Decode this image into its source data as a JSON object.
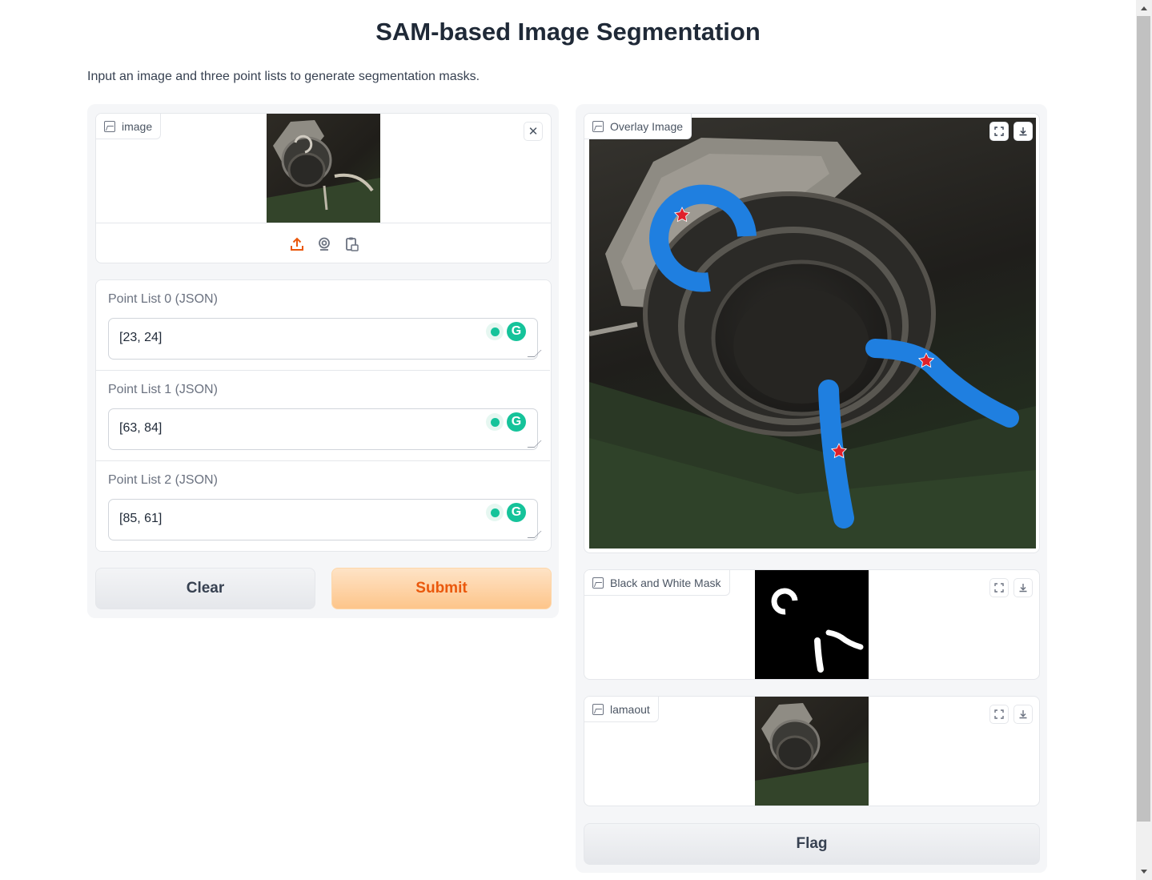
{
  "header": {
    "title": "SAM-based Image Segmentation",
    "subtitle": "Input an image and three point lists to generate segmentation masks."
  },
  "input_image": {
    "label": "image",
    "upload_icon": "upload-icon",
    "webcam_icon": "webcam-icon",
    "clipboard_icon": "clipboard-icon",
    "close_icon": "close-icon"
  },
  "fields": [
    {
      "label": "Point List 0 (JSON)",
      "value": "[23, 24]"
    },
    {
      "label": "Point List 1 (JSON)",
      "value": "[63, 84]"
    },
    {
      "label": "Point List 2 (JSON)",
      "value": "[85, 61]"
    }
  ],
  "grammarly_label": "G",
  "buttons": {
    "clear": "Clear",
    "submit": "Submit",
    "flag": "Flag"
  },
  "outputs": {
    "overlay": {
      "label": "Overlay Image"
    },
    "mask": {
      "label": "Black and White Mask"
    },
    "lama": {
      "label": "lamaout"
    }
  },
  "colors": {
    "accent": "#ea580c",
    "mask_blue": "#1f7fe0",
    "star_red": "#e0202a",
    "grammarly": "#15c39a"
  }
}
